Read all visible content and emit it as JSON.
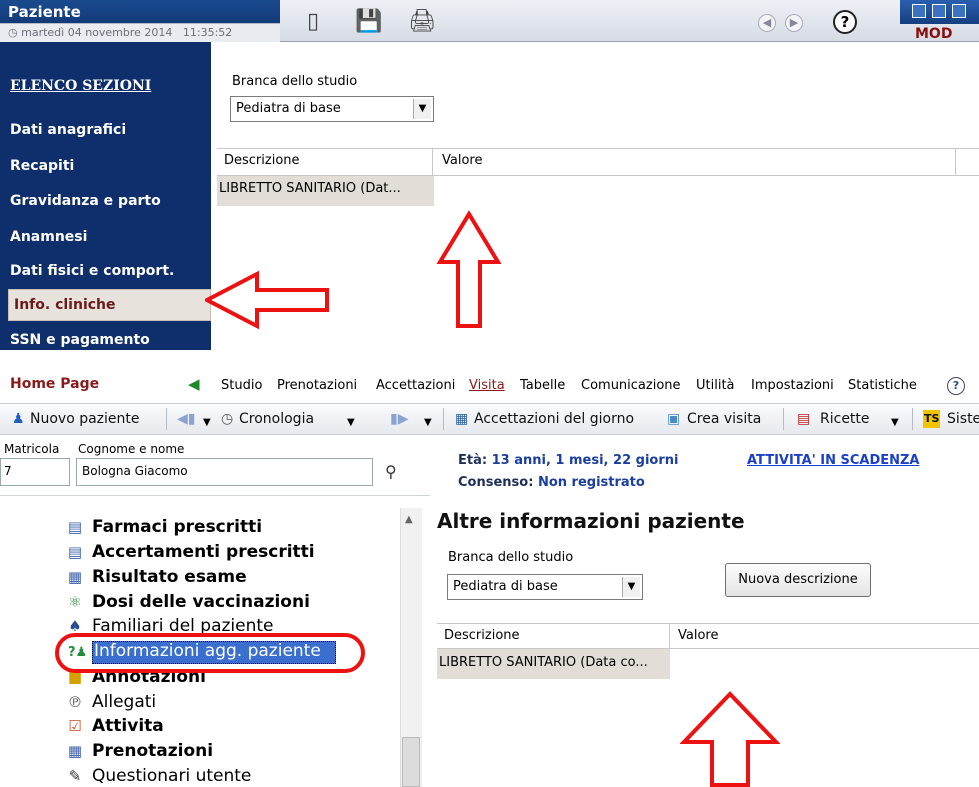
{
  "top_window": {
    "title": "Paziente",
    "datetime": "martedì 04 novembre 2014   11:35:52",
    "mode": "MOD",
    "help": "?",
    "sidebar": {
      "title": "ELENCO SEZIONI",
      "items": [
        "Dati anagrafici",
        "Recapiti",
        "Gravidanza e parto",
        "Anamnesi",
        "Dati fisici e comport.",
        "Info. cliniche",
        "SSN e pagamento"
      ],
      "selected": "Info. cliniche"
    },
    "branca_label": "Branca dello studio",
    "branca_value": "Pediatra di base",
    "grid": {
      "headers": [
        "Descrizione",
        "Valore"
      ],
      "rows": [
        [
          "LIBRETTO SANITARIO (Dat...",
          ""
        ]
      ]
    }
  },
  "bottom_window": {
    "home_link": "Home Page",
    "menu": [
      "Studio",
      "Prenotazioni",
      "Accettazioni",
      "Visita",
      "Tabelle",
      "Comunicazione",
      "Utilità",
      "Impostazioni",
      "Statistiche"
    ],
    "help": "?",
    "toolbar": {
      "nuovo_paziente": "Nuovo paziente",
      "cronologia": "Cronologia",
      "accettazioni_giorno": "Accettazioni del giorno",
      "crea_visita": "Crea visita",
      "ricette": "Ricette",
      "sistema": "Siste"
    },
    "patient": {
      "matricola_label": "Matricola",
      "matricola_value": "7",
      "cognome_label": "Cognome e nome",
      "cognome_value": "Bologna Giacomo",
      "eta_label": "Età:",
      "eta_value": "13 anni, 1 mesi, 22 giorni",
      "consenso_label": "Consenso:",
      "consenso_value": "Non registrato",
      "attivita_link": "ATTIVITA' IN SCADENZA"
    },
    "tree": [
      {
        "label": "Farmaci prescritti",
        "bold": true,
        "icon": "list-icon"
      },
      {
        "label": "Accertamenti prescritti",
        "bold": true,
        "icon": "list-icon"
      },
      {
        "label": "Risultato esame",
        "bold": true,
        "icon": "grid-icon"
      },
      {
        "label": "Dosi delle vaccinazioni",
        "bold": true,
        "icon": "vaccine-icon"
      },
      {
        "label": "Familiari del paziente",
        "bold": false,
        "icon": "family-icon"
      },
      {
        "label": "Informazioni agg. paziente",
        "bold": false,
        "icon": "info-icon",
        "selected": true
      },
      {
        "label": "Annotazioni",
        "bold": true,
        "icon": "note-icon"
      },
      {
        "label": "Allegati",
        "bold": false,
        "icon": "paperclip-icon"
      },
      {
        "label": "Attivita",
        "bold": true,
        "icon": "task-icon"
      },
      {
        "label": "Prenotazioni",
        "bold": true,
        "icon": "calendar-icon"
      },
      {
        "label": "Questionari utente",
        "bold": false,
        "icon": "form-icon"
      }
    ],
    "panel_title": "Altre informazioni paziente",
    "branca_label": "Branca dello studio",
    "branca_value": "Pediatra di base",
    "nuova_descrizione": "Nuova descrizione",
    "grid": {
      "headers": [
        "Descrizione",
        "Valore"
      ],
      "rows": [
        [
          "LIBRETTO SANITARIO (Data co...",
          ""
        ]
      ]
    }
  },
  "colors": {
    "sidebar": "#0e2f6b",
    "highlight": "#e11",
    "link": "#1a3fc8"
  }
}
